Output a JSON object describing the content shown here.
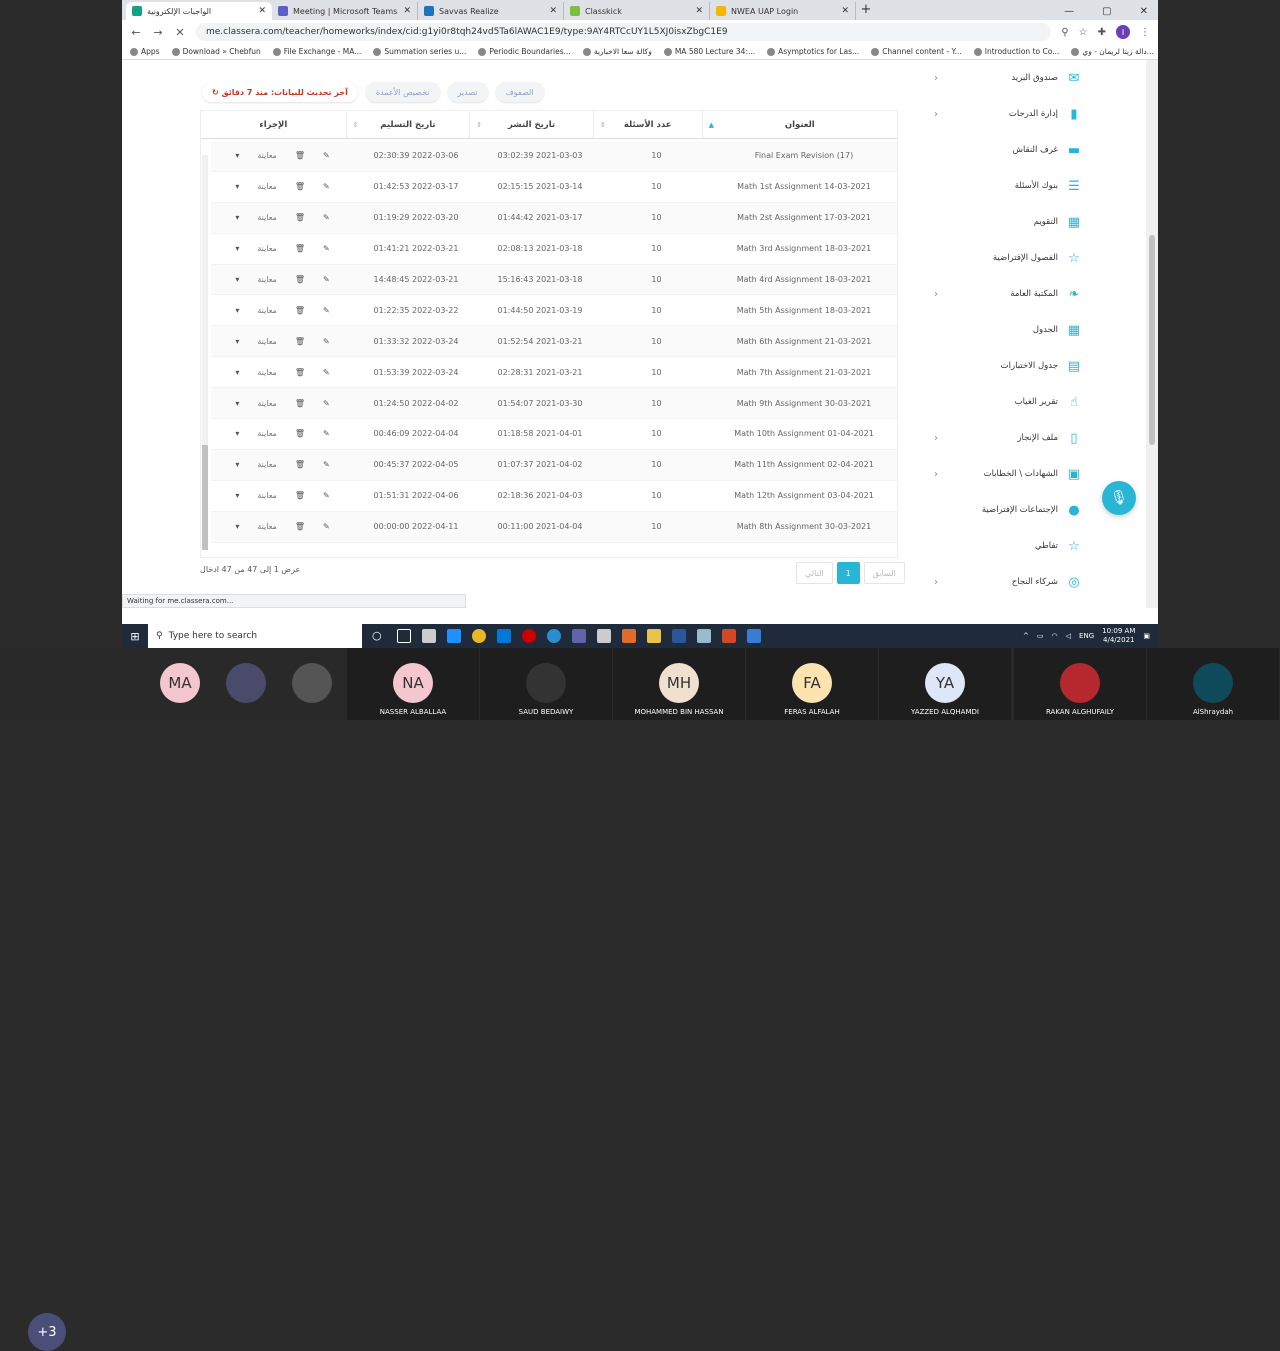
{
  "browser": {
    "tabs": [
      {
        "title": "الواجبات الإلكترونية",
        "color": "#16a085",
        "active": true
      },
      {
        "title": "Meeting | Microsoft Teams",
        "color": "#5b5fc7",
        "active": false
      },
      {
        "title": "Savvas Realize",
        "color": "#1e73be",
        "active": false
      },
      {
        "title": "Classkick",
        "color": "#7ac143",
        "active": false
      },
      {
        "title": "NWEA UAP Login",
        "color": "#f2b701",
        "active": false
      }
    ],
    "url": "me.classera.com/teacher/homeworks/index/cid:g1yi0r8tqh24vd5Ta6lAWAC1E9/type:9AY4RTCcUY1L5XJ0isxZbgC1E9",
    "bookmarks": [
      "Apps",
      "Download » Chebfun",
      "File Exchange - MA...",
      "Summation series u...",
      "Periodic Boundaries...",
      "وكالة سعا الاخبارية",
      "MA 580 Lecture 34:...",
      "Asymptotics for Las...",
      "Channel content - Y...",
      "Introduction to Co...",
      "دالة زيتا لريمان - وي..."
    ],
    "status": "Waiting for me.classera.com..."
  },
  "top_buttons": {
    "rows": "الصفوف",
    "export": "تصدير",
    "columns": "تخصيص الأعمدة",
    "refresh": "آخر تحديث للبيانات: منذ 7 دقائق"
  },
  "table": {
    "headers": {
      "title": "العنوان",
      "count": "عدد الأسئلة",
      "published": "تاريخ النشر",
      "due": "تاريخ التسليم",
      "action": "الإجراء"
    },
    "preview_label": "معاينة",
    "rows": [
      {
        "title": "Final Exam Revision (17)",
        "count": "10",
        "published": "2021-03-03 03:02:39",
        "due": "2022-03-06 02:30:39"
      },
      {
        "title": "Math 1st Assignment 14-03-2021",
        "count": "10",
        "published": "2021-03-14 02:15:15",
        "due": "2022-03-17 01:42:53"
      },
      {
        "title": "Math 2st Assignment 17-03-2021",
        "count": "10",
        "published": "2021-03-17 01:44:42",
        "due": "2022-03-20 01:19:29"
      },
      {
        "title": "Math 3rd Assignment 18-03-2021",
        "count": "10",
        "published": "2021-03-18 02:08:13",
        "due": "2022-03-21 01:41:21"
      },
      {
        "title": "Math 4rd Assignment 18-03-2021",
        "count": "10",
        "published": "2021-03-18 15:16:43",
        "due": "2022-03-21 14:48:45"
      },
      {
        "title": "Math 5th Assignment 18-03-2021",
        "count": "10",
        "published": "2021-03-19 01:44:50",
        "due": "2022-03-22 01:22:35"
      },
      {
        "title": "Math 6th Assignment 21-03-2021",
        "count": "10",
        "published": "2021-03-21 01:52:54",
        "due": "2022-03-24 01:33:32"
      },
      {
        "title": "Math 7th Assignment 21-03-2021",
        "count": "10",
        "published": "2021-03-21 02:28:31",
        "due": "2022-03-24 01:53:39"
      },
      {
        "title": "Math 9th Assignment 30-03-2021",
        "count": "10",
        "published": "2021-03-30 01:54:07",
        "due": "2022-04-02 01:24:50"
      },
      {
        "title": "Math 10th Assignment 01-04-2021",
        "count": "10",
        "published": "2021-04-01 01:18:58",
        "due": "2022-04-04 00:46:09"
      },
      {
        "title": "Math 11th Assignment 02-04-2021",
        "count": "10",
        "published": "2021-04-02 01:07:37",
        "due": "2022-04-05 00:45:37"
      },
      {
        "title": "Math 12th Assignment 03-04-2021",
        "count": "10",
        "published": "2021-04-03 02:18:36",
        "due": "2022-04-06 01:51:31"
      },
      {
        "title": "Math 8th Assignment 30-03-2021",
        "count": "10",
        "published": "2021-04-04 00:11:00",
        "due": "2022-04-11 00:00:00"
      }
    ]
  },
  "pagination": {
    "info": "عرض 1 إلى 47 من 47 ادخال",
    "prev": "السابق",
    "page": "1",
    "next": "التالي"
  },
  "sidebar": {
    "items": [
      {
        "label": "صندوق البريد",
        "icon": "✉",
        "chevron": true
      },
      {
        "label": "إدارة الدرجات",
        "icon": "▮",
        "chevron": true
      },
      {
        "label": "غرف النقاش",
        "icon": "▬",
        "chevron": false
      },
      {
        "label": "بنوك الأسئلة",
        "icon": "☰",
        "chevron": false
      },
      {
        "label": "التقويم",
        "icon": "▦",
        "chevron": false
      },
      {
        "label": "الفصول الإفتراضية",
        "icon": "☆",
        "chevron": false
      },
      {
        "label": "المكتبة العامة",
        "icon": "❧",
        "chevron": true
      },
      {
        "label": "الجدول",
        "icon": "▦",
        "chevron": false
      },
      {
        "label": "جدول الاختبارات",
        "icon": "▤",
        "chevron": false
      },
      {
        "label": "تقرير الغياب",
        "icon": "☝",
        "chevron": false
      },
      {
        "label": "ملف الإنجاز",
        "icon": "▯",
        "chevron": true
      },
      {
        "label": "الشهادات \\ الخطابات",
        "icon": "▣",
        "chevron": true
      },
      {
        "label": "الإجتماعات الإفتراضية",
        "icon": "●",
        "chevron": false
      },
      {
        "label": "تفاطي",
        "icon": "☆",
        "chevron": false
      },
      {
        "label": "شركاء النجاح",
        "icon": "◎",
        "chevron": true
      }
    ]
  },
  "taskbar": {
    "search_placeholder": "Type here to search",
    "lang": "ENG",
    "time": "10:09 AM",
    "date": "4/4/2021"
  },
  "meeting": {
    "overflow": "+3",
    "participants": [
      {
        "initials": "MA",
        "name": "",
        "color": "#f4c6cf"
      },
      {
        "initials": "",
        "name": "",
        "color": "#4a4a6a"
      },
      {
        "initials": "",
        "name": "",
        "color": "#555"
      },
      {
        "initials": "NA",
        "name": "NASSER ALBALLAA",
        "color": "#f4c6cf"
      },
      {
        "initials": "",
        "name": "SAUD BEDAIWY",
        "color": "#333"
      },
      {
        "initials": "MH",
        "name": "MOHAMMED BIN HASSAN",
        "color": "#f0e0d0"
      },
      {
        "initials": "FA",
        "name": "FERAS ALFALAH",
        "color": "#fde3b0"
      },
      {
        "initials": "YA",
        "name": "YAZZED ALQHAMDI",
        "color": "#dde7f7"
      },
      {
        "initials": "",
        "name": "RAKAN ALGHUFAILY",
        "color": "#b5282e"
      },
      {
        "initials": "",
        "name": "AlShraydah",
        "color": "#0e4a5a"
      }
    ]
  }
}
